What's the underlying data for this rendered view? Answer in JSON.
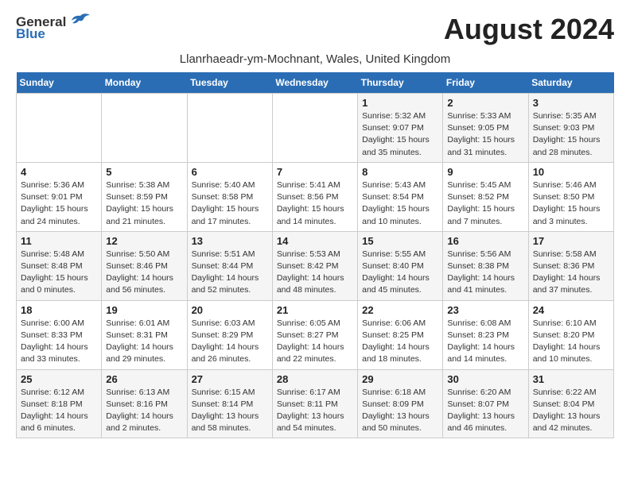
{
  "header": {
    "logo_general": "General",
    "logo_blue": "Blue",
    "month_title": "August 2024",
    "location": "Llanrhaeadr-ym-Mochnant, Wales, United Kingdom"
  },
  "weekdays": [
    "Sunday",
    "Monday",
    "Tuesday",
    "Wednesday",
    "Thursday",
    "Friday",
    "Saturday"
  ],
  "weeks": [
    [
      {
        "day": "",
        "info": ""
      },
      {
        "day": "",
        "info": ""
      },
      {
        "day": "",
        "info": ""
      },
      {
        "day": "",
        "info": ""
      },
      {
        "day": "1",
        "info": "Sunrise: 5:32 AM\nSunset: 9:07 PM\nDaylight: 15 hours\nand 35 minutes."
      },
      {
        "day": "2",
        "info": "Sunrise: 5:33 AM\nSunset: 9:05 PM\nDaylight: 15 hours\nand 31 minutes."
      },
      {
        "day": "3",
        "info": "Sunrise: 5:35 AM\nSunset: 9:03 PM\nDaylight: 15 hours\nand 28 minutes."
      }
    ],
    [
      {
        "day": "4",
        "info": "Sunrise: 5:36 AM\nSunset: 9:01 PM\nDaylight: 15 hours\nand 24 minutes."
      },
      {
        "day": "5",
        "info": "Sunrise: 5:38 AM\nSunset: 8:59 PM\nDaylight: 15 hours\nand 21 minutes."
      },
      {
        "day": "6",
        "info": "Sunrise: 5:40 AM\nSunset: 8:58 PM\nDaylight: 15 hours\nand 17 minutes."
      },
      {
        "day": "7",
        "info": "Sunrise: 5:41 AM\nSunset: 8:56 PM\nDaylight: 15 hours\nand 14 minutes."
      },
      {
        "day": "8",
        "info": "Sunrise: 5:43 AM\nSunset: 8:54 PM\nDaylight: 15 hours\nand 10 minutes."
      },
      {
        "day": "9",
        "info": "Sunrise: 5:45 AM\nSunset: 8:52 PM\nDaylight: 15 hours\nand 7 minutes."
      },
      {
        "day": "10",
        "info": "Sunrise: 5:46 AM\nSunset: 8:50 PM\nDaylight: 15 hours\nand 3 minutes."
      }
    ],
    [
      {
        "day": "11",
        "info": "Sunrise: 5:48 AM\nSunset: 8:48 PM\nDaylight: 15 hours\nand 0 minutes."
      },
      {
        "day": "12",
        "info": "Sunrise: 5:50 AM\nSunset: 8:46 PM\nDaylight: 14 hours\nand 56 minutes."
      },
      {
        "day": "13",
        "info": "Sunrise: 5:51 AM\nSunset: 8:44 PM\nDaylight: 14 hours\nand 52 minutes."
      },
      {
        "day": "14",
        "info": "Sunrise: 5:53 AM\nSunset: 8:42 PM\nDaylight: 14 hours\nand 48 minutes."
      },
      {
        "day": "15",
        "info": "Sunrise: 5:55 AM\nSunset: 8:40 PM\nDaylight: 14 hours\nand 45 minutes."
      },
      {
        "day": "16",
        "info": "Sunrise: 5:56 AM\nSunset: 8:38 PM\nDaylight: 14 hours\nand 41 minutes."
      },
      {
        "day": "17",
        "info": "Sunrise: 5:58 AM\nSunset: 8:36 PM\nDaylight: 14 hours\nand 37 minutes."
      }
    ],
    [
      {
        "day": "18",
        "info": "Sunrise: 6:00 AM\nSunset: 8:33 PM\nDaylight: 14 hours\nand 33 minutes."
      },
      {
        "day": "19",
        "info": "Sunrise: 6:01 AM\nSunset: 8:31 PM\nDaylight: 14 hours\nand 29 minutes."
      },
      {
        "day": "20",
        "info": "Sunrise: 6:03 AM\nSunset: 8:29 PM\nDaylight: 14 hours\nand 26 minutes."
      },
      {
        "day": "21",
        "info": "Sunrise: 6:05 AM\nSunset: 8:27 PM\nDaylight: 14 hours\nand 22 minutes."
      },
      {
        "day": "22",
        "info": "Sunrise: 6:06 AM\nSunset: 8:25 PM\nDaylight: 14 hours\nand 18 minutes."
      },
      {
        "day": "23",
        "info": "Sunrise: 6:08 AM\nSunset: 8:23 PM\nDaylight: 14 hours\nand 14 minutes."
      },
      {
        "day": "24",
        "info": "Sunrise: 6:10 AM\nSunset: 8:20 PM\nDaylight: 14 hours\nand 10 minutes."
      }
    ],
    [
      {
        "day": "25",
        "info": "Sunrise: 6:12 AM\nSunset: 8:18 PM\nDaylight: 14 hours\nand 6 minutes."
      },
      {
        "day": "26",
        "info": "Sunrise: 6:13 AM\nSunset: 8:16 PM\nDaylight: 14 hours\nand 2 minutes."
      },
      {
        "day": "27",
        "info": "Sunrise: 6:15 AM\nSunset: 8:14 PM\nDaylight: 13 hours\nand 58 minutes."
      },
      {
        "day": "28",
        "info": "Sunrise: 6:17 AM\nSunset: 8:11 PM\nDaylight: 13 hours\nand 54 minutes."
      },
      {
        "day": "29",
        "info": "Sunrise: 6:18 AM\nSunset: 8:09 PM\nDaylight: 13 hours\nand 50 minutes."
      },
      {
        "day": "30",
        "info": "Sunrise: 6:20 AM\nSunset: 8:07 PM\nDaylight: 13 hours\nand 46 minutes."
      },
      {
        "day": "31",
        "info": "Sunrise: 6:22 AM\nSunset: 8:04 PM\nDaylight: 13 hours\nand 42 minutes."
      }
    ]
  ]
}
